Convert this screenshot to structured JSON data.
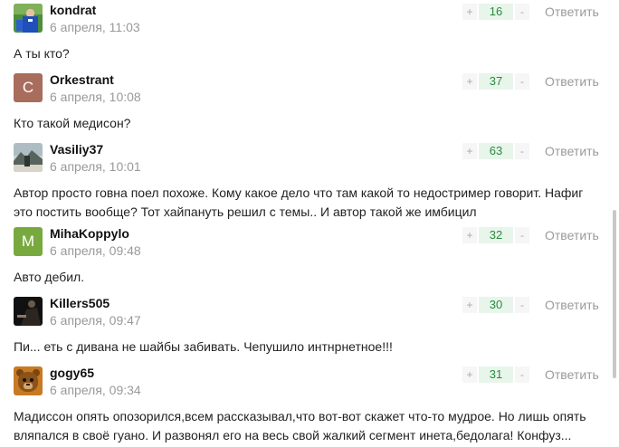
{
  "actions": {
    "plus": "+",
    "minus": "-",
    "reply": "Ответить"
  },
  "comments": [
    {
      "author": "kondrat",
      "date": "6 апреля, 11:03",
      "score": "16",
      "text": "А ты кто?",
      "avatar": {
        "type": "photo",
        "icon": "soccer-player-photo"
      }
    },
    {
      "author": "Orkestrant",
      "date": "6 апреля, 10:08",
      "score": "37",
      "text": "Кто такой медисон?",
      "avatar": {
        "type": "letter",
        "letter": "C",
        "color": "#a86d5c"
      }
    },
    {
      "author": "Vasiliy37",
      "date": "6 апреля, 10:01",
      "score": "63",
      "text": "Автор просто говна поел похоже. Кому какое дело что там какой то недостример говорит. Нафиг это постить вообще? Тот хайпануть решил с темы.. И автор такой же имбицил",
      "avatar": {
        "type": "photo",
        "icon": "landscape-photo"
      }
    },
    {
      "author": "MihaKoppylo",
      "date": "6 апреля, 09:48",
      "score": "32",
      "text": "Авто дебил.",
      "avatar": {
        "type": "letter",
        "letter": "M",
        "color": "#78a93e"
      }
    },
    {
      "author": "Killers505",
      "date": "6 апреля, 09:47",
      "score": "30",
      "text": "Пи... еть с дивана не шайбы забивать. Чепушило интнрнетное!!!",
      "avatar": {
        "type": "photo",
        "icon": "dark-figure-photo"
      }
    },
    {
      "author": "gogy65",
      "date": "6 апреля, 09:34",
      "score": "31",
      "text": "Мадиссон опять опозорился,всем рассказывал,что вот-вот скажет что-то мудрое. Но лишь опять вляпался в своё гуано. И развонял его на весь свой жалкий сегмент инета,бедолага! Конфуз...",
      "avatar": {
        "type": "photo",
        "icon": "bear-cartoon-photo"
      }
    }
  ]
}
